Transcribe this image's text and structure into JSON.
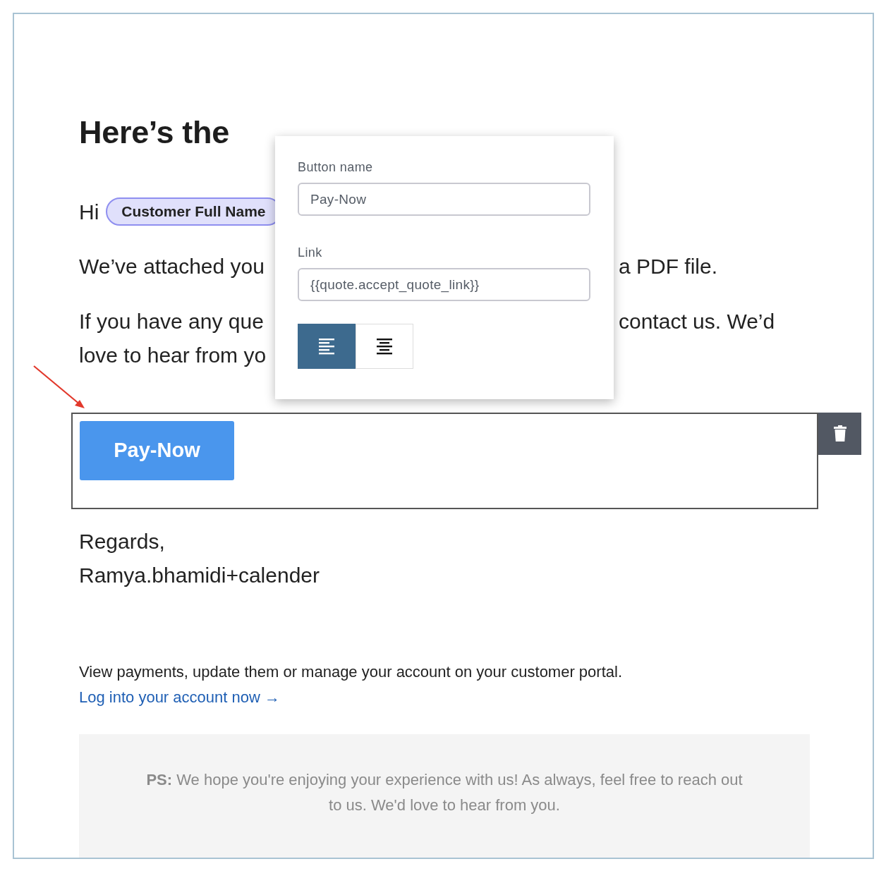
{
  "heading": "Here’s the",
  "greeting": {
    "text": "Hi",
    "tag": "Customer Full Name"
  },
  "paragraphs": [
    {
      "left": "We’ve attached you",
      "right": "a PDF file."
    },
    {
      "left": "If you have any que",
      "right": "contact us. We’d"
    },
    {
      "left": "love to hear from yo"
    }
  ],
  "button_block": {
    "label": "Pay-Now"
  },
  "signoff": [
    "Regards,",
    "Ramya.bhamidi+calender"
  ],
  "portal": {
    "text": "View payments, update them or manage your account on your customer portal.",
    "link": "Log into your account now →"
  },
  "ps": "**PS:** We hope you're enjoying your experience with us! As always, feel free to reach out to us. We'd love to hear from you.",
  "popover": {
    "fields": [
      {
        "label": "Button name",
        "value": "Pay-Now"
      },
      {
        "label": "Link",
        "value": "{{quote.accept_quote_link}}"
      }
    ],
    "alignment": [
      {
        "kind": "left",
        "selected": true
      },
      {
        "kind": "center",
        "selected": false
      }
    ]
  }
}
